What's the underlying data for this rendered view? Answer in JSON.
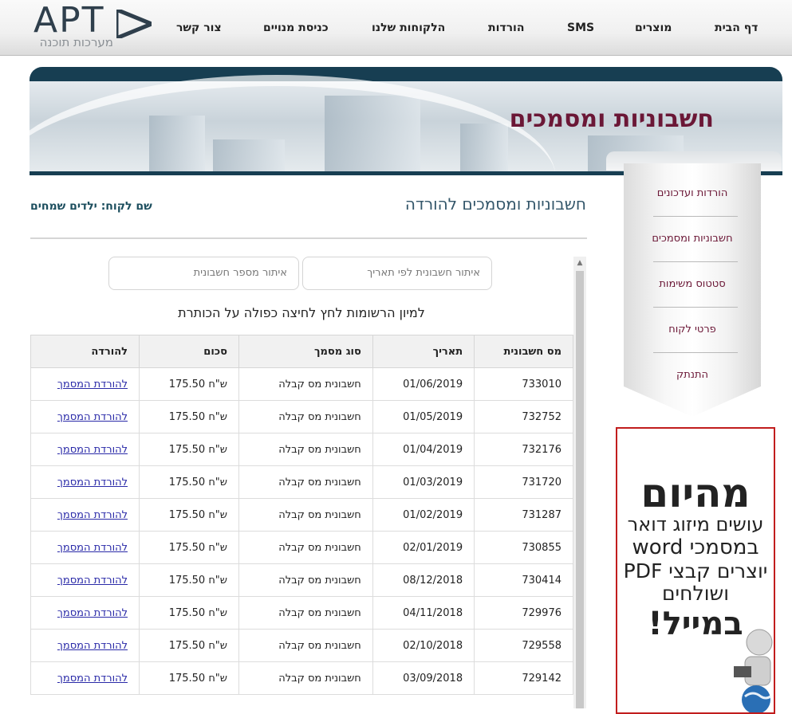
{
  "logo": {
    "mark": "APT",
    "tagline": "מערכות תוכנה"
  },
  "nav": {
    "items": [
      "דף הבית",
      "מוצרים",
      "SMS",
      "הורדות",
      "הלקוחות שלנו",
      "כניסת מנויים",
      "צור קשר"
    ]
  },
  "banner": {
    "title": "חשבוניות ומסמכים"
  },
  "sidebar": {
    "items": [
      "הורדות ועדכונים",
      "חשבוניות ומסמכים",
      "סטטוס משימות",
      "פרטי לקוח",
      "התנתק"
    ]
  },
  "ad": {
    "headline": "מהיום",
    "line1": "עושים מיזוג דואר",
    "line2": "במסמכי word",
    "line3": "יוצרים קבצי PDF",
    "line4": "ושולחים",
    "cta": "במייל!"
  },
  "main": {
    "heading": "חשבוניות ומסמכים להורדה",
    "customer_label": "שם לקוח:",
    "customer_name": "ילדים שמחים",
    "search_date_placeholder": "איתור חשבונית לפי תאריך",
    "search_number_placeholder": "איתור מספר חשבונית",
    "sort_hint": "למיון הרשומות לחץ לחיצה כפולה על הכותרת"
  },
  "table": {
    "columns": [
      "מס חשבונית",
      "תאריך",
      "סוג מסמך",
      "סכום",
      "להורדה"
    ],
    "rows": [
      {
        "number": "733010",
        "date": "01/06/2019",
        "type": "חשבונית מס קבלה",
        "amount": "175.50 ש\"ח",
        "download": "להורדת המסמך"
      },
      {
        "number": "732752",
        "date": "01/05/2019",
        "type": "חשבונית מס קבלה",
        "amount": "175.50 ש\"ח",
        "download": "להורדת המסמך"
      },
      {
        "number": "732176",
        "date": "01/04/2019",
        "type": "חשבונית מס קבלה",
        "amount": "175.50 ש\"ח",
        "download": "להורדת המסמך"
      },
      {
        "number": "731720",
        "date": "01/03/2019",
        "type": "חשבונית מס קבלה",
        "amount": "175.50 ש\"ח",
        "download": "להורדת המסמך"
      },
      {
        "number": "731287",
        "date": "01/02/2019",
        "type": "חשבונית מס קבלה",
        "amount": "175.50 ש\"ח",
        "download": "להורדת המסמך"
      },
      {
        "number": "730855",
        "date": "02/01/2019",
        "type": "חשבונית מס קבלה",
        "amount": "175.50 ש\"ח",
        "download": "להורדת המסמך"
      },
      {
        "number": "730414",
        "date": "08/12/2018",
        "type": "חשבונית מס קבלה",
        "amount": "175.50 ש\"ח",
        "download": "להורדת המסמך"
      },
      {
        "number": "729976",
        "date": "04/11/2018",
        "type": "חשבונית מס קבלה",
        "amount": "175.50 ש\"ח",
        "download": "להורדת המסמך"
      },
      {
        "number": "729558",
        "date": "02/10/2018",
        "type": "חשבונית מס קבלה",
        "amount": "175.50 ש\"ח",
        "download": "להורדת המסמך"
      },
      {
        "number": "729142",
        "date": "03/09/2018",
        "type": "חשבונית מס קבלה",
        "amount": "175.50 ש\"ח",
        "download": "להורדת המסמך"
      }
    ]
  },
  "colors": {
    "accent": "#6b1736",
    "banner_dark": "#173e52",
    "ad_border": "#c11d1d",
    "link": "#2a2aa8"
  }
}
